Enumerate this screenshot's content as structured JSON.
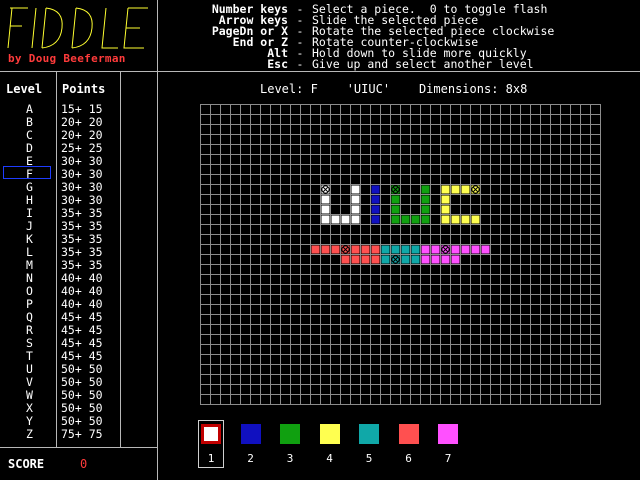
{
  "app": {
    "logo_text": "FIDDLE",
    "byline": "by Doug Beeferman"
  },
  "help": [
    {
      "key": "Number keys",
      "desc": "Select a piece.  0 to toggle flash"
    },
    {
      "key": "Arrow keys",
      "desc": "Slide the selected piece"
    },
    {
      "key": "PageDn or X",
      "desc": "Rotate the selected piece clockwise"
    },
    {
      "key": "End or Z",
      "desc": "Rotate counter-clockwise"
    },
    {
      "key": "Alt",
      "desc": "Hold down to slide more quickly"
    },
    {
      "key": "Esc",
      "desc": "Give up and select another level"
    }
  ],
  "help_separator": "-",
  "levels_panel": {
    "header_level": "Level",
    "header_points": "Points",
    "selected": "F",
    "rows": [
      {
        "letter": "A",
        "points": "15+ 15"
      },
      {
        "letter": "B",
        "points": "20+ 20"
      },
      {
        "letter": "C",
        "points": "20+ 20"
      },
      {
        "letter": "D",
        "points": "25+ 25"
      },
      {
        "letter": "E",
        "points": "30+ 30"
      },
      {
        "letter": "F",
        "points": "30+ 30"
      },
      {
        "letter": "G",
        "points": "30+ 30"
      },
      {
        "letter": "H",
        "points": "30+ 30"
      },
      {
        "letter": "I",
        "points": "35+ 35"
      },
      {
        "letter": "J",
        "points": "35+ 35"
      },
      {
        "letter": "K",
        "points": "35+ 35"
      },
      {
        "letter": "L",
        "points": "35+ 35"
      },
      {
        "letter": "M",
        "points": "35+ 35"
      },
      {
        "letter": "N",
        "points": "40+ 40"
      },
      {
        "letter": "O",
        "points": "40+ 40"
      },
      {
        "letter": "P",
        "points": "40+ 40"
      },
      {
        "letter": "Q",
        "points": "45+ 45"
      },
      {
        "letter": "R",
        "points": "45+ 45"
      },
      {
        "letter": "S",
        "points": "45+ 45"
      },
      {
        "letter": "T",
        "points": "45+ 45"
      },
      {
        "letter": "U",
        "points": "50+ 50"
      },
      {
        "letter": "V",
        "points": "50+ 50"
      },
      {
        "letter": "W",
        "points": "50+ 50"
      },
      {
        "letter": "X",
        "points": "50+ 50"
      },
      {
        "letter": "Y",
        "points": "50+ 50"
      },
      {
        "letter": "Z",
        "points": "75+ 75"
      }
    ]
  },
  "score": {
    "label": "SCORE",
    "value": "0"
  },
  "level_info": "Level: F    'UIUC'    Dimensions: 8x8",
  "board": {
    "cols": 40,
    "rows": 30,
    "grid_color": "#8c8c8c",
    "cells": [
      {
        "c": 12,
        "r": 8,
        "color": "#ffffff",
        "mark": true
      },
      {
        "c": 12,
        "r": 9,
        "color": "#ffffff"
      },
      {
        "c": 12,
        "r": 10,
        "color": "#ffffff"
      },
      {
        "c": 12,
        "r": 11,
        "color": "#ffffff"
      },
      {
        "c": 13,
        "r": 11,
        "color": "#ffffff"
      },
      {
        "c": 14,
        "r": 11,
        "color": "#ffffff"
      },
      {
        "c": 15,
        "r": 8,
        "color": "#ffffff"
      },
      {
        "c": 15,
        "r": 9,
        "color": "#ffffff"
      },
      {
        "c": 15,
        "r": 10,
        "color": "#ffffff"
      },
      {
        "c": 15,
        "r": 11,
        "color": "#ffffff"
      },
      {
        "c": 17,
        "r": 8,
        "color": "#1010c0"
      },
      {
        "c": 17,
        "r": 9,
        "color": "#1010c0"
      },
      {
        "c": 17,
        "r": 10,
        "color": "#1010c0"
      },
      {
        "c": 17,
        "r": 11,
        "color": "#1010c0"
      },
      {
        "c": 19,
        "r": 8,
        "color": "#10a010",
        "mark": true
      },
      {
        "c": 19,
        "r": 9,
        "color": "#10a010"
      },
      {
        "c": 19,
        "r": 10,
        "color": "#10a010"
      },
      {
        "c": 19,
        "r": 11,
        "color": "#10a010"
      },
      {
        "c": 20,
        "r": 11,
        "color": "#10a010"
      },
      {
        "c": 21,
        "r": 11,
        "color": "#10a010"
      },
      {
        "c": 22,
        "r": 8,
        "color": "#10a010"
      },
      {
        "c": 22,
        "r": 9,
        "color": "#10a010"
      },
      {
        "c": 22,
        "r": 10,
        "color": "#10a010"
      },
      {
        "c": 22,
        "r": 11,
        "color": "#10a010"
      },
      {
        "c": 24,
        "r": 8,
        "color": "#ffff50"
      },
      {
        "c": 25,
        "r": 8,
        "color": "#ffff50"
      },
      {
        "c": 26,
        "r": 8,
        "color": "#ffff50"
      },
      {
        "c": 27,
        "r": 8,
        "color": "#ffff50",
        "mark": true
      },
      {
        "c": 24,
        "r": 9,
        "color": "#ffff50"
      },
      {
        "c": 24,
        "r": 10,
        "color": "#ffff50"
      },
      {
        "c": 24,
        "r": 11,
        "color": "#ffff50"
      },
      {
        "c": 25,
        "r": 11,
        "color": "#ffff50"
      },
      {
        "c": 26,
        "r": 11,
        "color": "#ffff50"
      },
      {
        "c": 27,
        "r": 11,
        "color": "#ffff50"
      },
      {
        "c": 11,
        "r": 14,
        "color": "#ff5050"
      },
      {
        "c": 12,
        "r": 14,
        "color": "#ff5050"
      },
      {
        "c": 13,
        "r": 14,
        "color": "#ff5050"
      },
      {
        "c": 14,
        "r": 14,
        "color": "#ff5050",
        "mark": true
      },
      {
        "c": 15,
        "r": 14,
        "color": "#ff5050"
      },
      {
        "c": 16,
        "r": 14,
        "color": "#ff5050"
      },
      {
        "c": 17,
        "r": 14,
        "color": "#ff5050"
      },
      {
        "c": 18,
        "r": 14,
        "color": "#10a8a8"
      },
      {
        "c": 19,
        "r": 14,
        "color": "#10a8a8"
      },
      {
        "c": 20,
        "r": 14,
        "color": "#10a8a8"
      },
      {
        "c": 21,
        "r": 14,
        "color": "#10a8a8"
      },
      {
        "c": 22,
        "r": 14,
        "color": "#ff50ff"
      },
      {
        "c": 23,
        "r": 14,
        "color": "#ff50ff"
      },
      {
        "c": 24,
        "r": 14,
        "color": "#ff50ff",
        "mark": true
      },
      {
        "c": 25,
        "r": 14,
        "color": "#ff50ff"
      },
      {
        "c": 26,
        "r": 14,
        "color": "#ff50ff"
      },
      {
        "c": 27,
        "r": 14,
        "color": "#ff50ff"
      },
      {
        "c": 28,
        "r": 14,
        "color": "#ff50ff"
      },
      {
        "c": 14,
        "r": 15,
        "color": "#ff5050"
      },
      {
        "c": 15,
        "r": 15,
        "color": "#ff5050"
      },
      {
        "c": 16,
        "r": 15,
        "color": "#ff5050"
      },
      {
        "c": 17,
        "r": 15,
        "color": "#ff5050"
      },
      {
        "c": 18,
        "r": 15,
        "color": "#10a8a8"
      },
      {
        "c": 19,
        "r": 15,
        "color": "#10a8a8",
        "mark": true
      },
      {
        "c": 20,
        "r": 15,
        "color": "#10a8a8"
      },
      {
        "c": 21,
        "r": 15,
        "color": "#10a8a8"
      },
      {
        "c": 22,
        "r": 15,
        "color": "#ff50ff"
      },
      {
        "c": 23,
        "r": 15,
        "color": "#ff50ff"
      },
      {
        "c": 24,
        "r": 15,
        "color": "#ff50ff"
      },
      {
        "c": 25,
        "r": 15,
        "color": "#ff50ff"
      }
    ]
  },
  "palette": {
    "selected": "1",
    "pieces": [
      {
        "num": "1",
        "color": "#ffffff",
        "name": "piece-1-white"
      },
      {
        "num": "2",
        "color": "#1010c0",
        "name": "piece-2-blue"
      },
      {
        "num": "3",
        "color": "#10a010",
        "name": "piece-3-green"
      },
      {
        "num": "4",
        "color": "#ffff50",
        "name": "piece-4-yellow"
      },
      {
        "num": "5",
        "color": "#10a8a8",
        "name": "piece-5-cyan"
      },
      {
        "num": "6",
        "color": "#ff5050",
        "name": "piece-6-red"
      },
      {
        "num": "7",
        "color": "#ff50ff",
        "name": "piece-7-magenta"
      }
    ]
  }
}
